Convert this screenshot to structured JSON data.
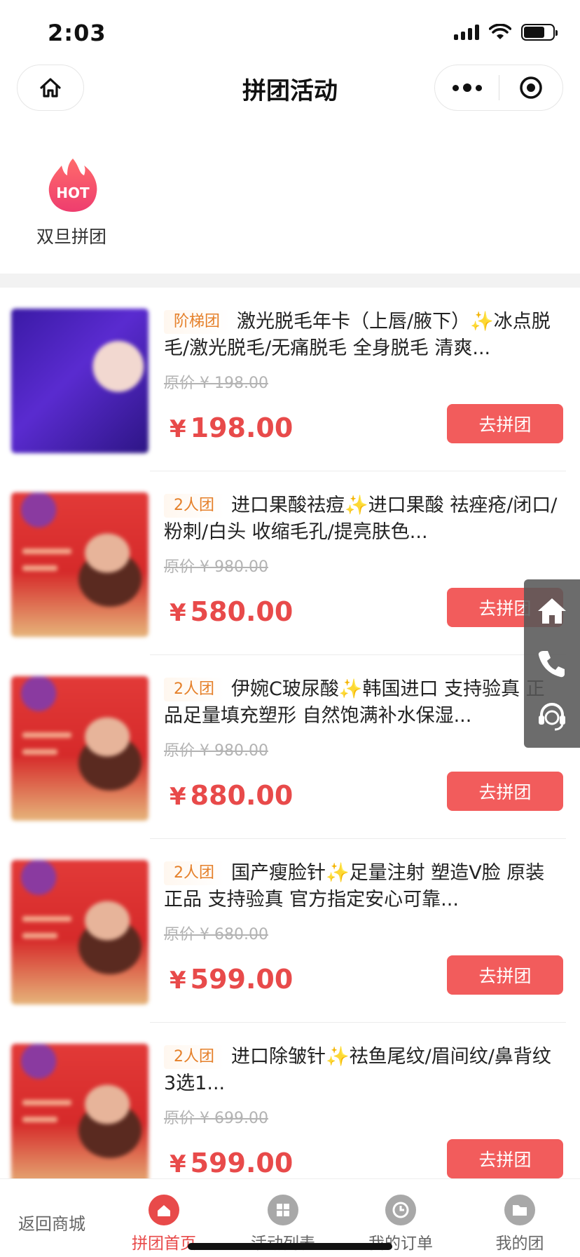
{
  "status_bar": {
    "time": "2:03"
  },
  "nav": {
    "title": "拼团活动"
  },
  "hot": {
    "badge_text": "HOT",
    "label": "双旦拼团"
  },
  "products": [
    {
      "tag": "阶梯团",
      "name": "激光脱毛年卡（上唇/腋下）",
      "spark": "✨",
      "desc": "冰点脱毛/激光脱毛/无痛脱毛 全身脱毛 清爽...",
      "original_price": "原价 ¥ 198.00",
      "currency": "¥",
      "price": "198.00",
      "button": "去拼团"
    },
    {
      "tag": "2人团",
      "name": "进口果酸祛痘",
      "spark": "✨",
      "desc": "进口果酸 祛痤疮/闭口/粉刺/白头 收缩毛孔/提亮肤色...",
      "original_price": "原价 ¥ 980.00",
      "currency": "¥",
      "price": "580.00",
      "button": "去拼团"
    },
    {
      "tag": "2人团",
      "name": "伊婉C玻尿酸",
      "spark": "✨",
      "desc": "韩国进口 支持验真 正品足量填充塑形 自然饱满补水保湿...",
      "original_price": "原价 ¥ 980.00",
      "currency": "¥",
      "price": "880.00",
      "button": "去拼团"
    },
    {
      "tag": "2人团",
      "name": "国产瘦脸针",
      "spark": "✨",
      "desc": "足量注射 塑造V脸 原装正品 支持验真 官方指定安心可靠...",
      "original_price": "原价 ¥ 680.00",
      "currency": "¥",
      "price": "599.00",
      "button": "去拼团"
    },
    {
      "tag": "2人团",
      "name": "进口除皱针",
      "spark": "✨",
      "desc": "祛鱼尾纹/眉间纹/鼻背纹 3选1...",
      "original_price": "原价 ¥ 699.00",
      "currency": "¥",
      "price": "599.00",
      "button": "去拼团"
    }
  ],
  "float_panel": {
    "icons": [
      "home-icon",
      "phone-icon",
      "customer-service-icon"
    ]
  },
  "tabbar": {
    "back_label": "返回商城",
    "tabs": [
      {
        "label": "拼团首页",
        "icon": "home-icon",
        "active": true
      },
      {
        "label": "活动列表",
        "icon": "grid-icon",
        "active": false
      },
      {
        "label": "我的订单",
        "icon": "clock-icon",
        "active": false
      },
      {
        "label": "我的团",
        "icon": "folder-icon",
        "active": false
      }
    ]
  },
  "colors": {
    "accent": "#e84a4a",
    "button": "#f25c5c",
    "tag_text": "#e5802a"
  }
}
